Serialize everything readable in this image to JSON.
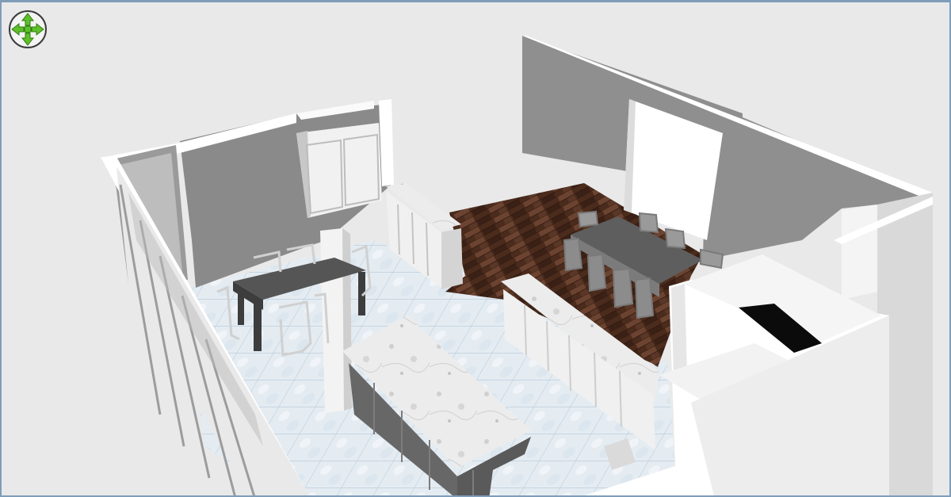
{
  "viewer": {
    "name": "3d-view",
    "background": "#e9e9e9",
    "border_color": "#7f9db9"
  },
  "navigation": {
    "icon": "navigation-arrows-icon",
    "arrow_color": "#5fbf2a",
    "ring_color": "#3b3b3b"
  },
  "scene": {
    "floor_tile_color": "#e3ebf1",
    "wood_floor_color": "#4a2a1c",
    "wall_color": "#8f8f8f",
    "wall_top_color": "#ffffff",
    "cabinet_color": "#f0f0f0",
    "marble_color": "#e8e8e8",
    "table_color": "#5b5b5b",
    "chair_color": "#8d8d8d"
  }
}
